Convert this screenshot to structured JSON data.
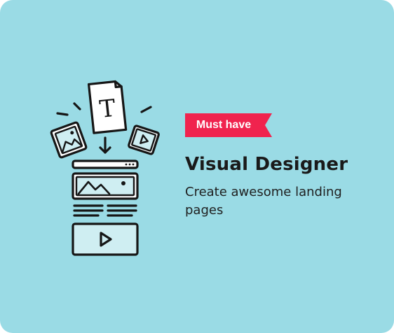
{
  "card": {
    "background_color": "#9adbe5",
    "badge": {
      "label": "Must have",
      "color": "#f0234e"
    },
    "title": "Visual Designer",
    "subtitle": "Create awesome landing pages"
  },
  "illustration": {
    "text_glyph": "T",
    "icons": [
      "image-file-icon",
      "text-file-icon",
      "video-file-icon",
      "arrow-down-icon",
      "webpage-layout-icon",
      "play-icon"
    ]
  }
}
